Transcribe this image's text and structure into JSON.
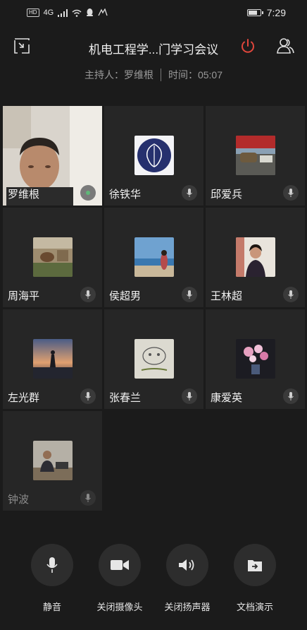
{
  "status_bar": {
    "network": "4G",
    "time": "7:29"
  },
  "header": {
    "title": "机电工程学...门学习会议",
    "host_label": "主持人：罗维根",
    "time_label": "时间：05:07"
  },
  "participants": [
    {
      "name": "罗维根"
    },
    {
      "name": "徐铁华"
    },
    {
      "name": "邱爱兵"
    },
    {
      "name": "周海平"
    },
    {
      "name": "侯超男"
    },
    {
      "name": "王林超"
    },
    {
      "name": "左光群"
    },
    {
      "name": "张春兰"
    },
    {
      "name": "康爱英"
    },
    {
      "name": "钟波"
    }
  ],
  "controls": {
    "mute": "静音",
    "camera": "关闭摄像头",
    "speaker": "关闭扬声器",
    "share": "文档演示"
  },
  "colors": {
    "accent_red": "#e0463c",
    "background": "#1b1b1b",
    "tile": "#262626"
  }
}
